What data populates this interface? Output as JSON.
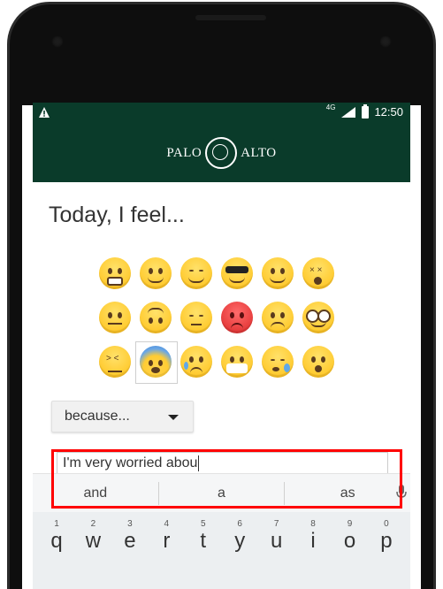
{
  "status_bar": {
    "network": "4G",
    "time": "12:50"
  },
  "header": {
    "logo_left": "PALO",
    "logo_right": "ALTO"
  },
  "main": {
    "title": "Today, I feel...",
    "emoji_rows": [
      [
        "grimacing-face-icon",
        "slightly-smiling-face-icon",
        "relieved-face-icon",
        "smiling-face-with-sunglasses-icon",
        "hugging-face-icon",
        "dizzy-face-icon"
      ],
      [
        "neutral-face-icon",
        "upside-down-face-icon",
        "pensive-face-icon",
        "pouting-face-icon",
        "frowning-face-icon",
        "nerd-face-icon"
      ],
      [
        "confounded-face-icon",
        "anxious-face-with-sweat-icon",
        "crying-face-icon",
        "face-with-medical-mask-icon",
        "sleepy-face-icon",
        "hushed-face-icon"
      ]
    ],
    "selected_emoji": "anxious-face-with-sweat-icon",
    "dropdown_label": "because...",
    "input_value": "I'm very worried abou"
  },
  "keyboard": {
    "suggestions": [
      "and",
      "a",
      "as"
    ],
    "number_hints": [
      "1",
      "2",
      "3",
      "4",
      "5",
      "6",
      "7",
      "8",
      "9",
      "0"
    ],
    "letters": [
      "q",
      "w",
      "e",
      "r",
      "t",
      "y",
      "u",
      "i",
      "o",
      "p"
    ]
  },
  "colors": {
    "header_bg": "#0a3b2a",
    "highlight": "#ff0000",
    "emoji_yellow": "#ffcc33",
    "emoji_red": "#e63b3b"
  }
}
